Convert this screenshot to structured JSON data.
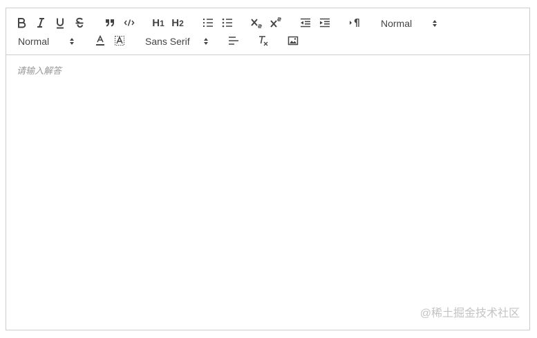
{
  "toolbar": {
    "row1": [
      {
        "name": "bold-button",
        "icon": "bold-icon"
      },
      {
        "name": "italic-button",
        "icon": "italic-icon"
      },
      {
        "name": "underline-button",
        "icon": "underline-icon"
      },
      {
        "name": "strike-button",
        "icon": "strikethrough-icon"
      },
      {
        "name": "blockquote-button",
        "icon": "quote-icon"
      },
      {
        "name": "code-block-button",
        "icon": "code-icon"
      },
      {
        "name": "header-1-button",
        "label": "H1"
      },
      {
        "name": "header-2-button",
        "label": "H2"
      },
      {
        "name": "ordered-list-button",
        "icon": "ordered-list-icon"
      },
      {
        "name": "bullet-list-button",
        "icon": "bullet-list-icon"
      },
      {
        "name": "subscript-button",
        "icon": "subscript-icon"
      },
      {
        "name": "superscript-button",
        "icon": "superscript-icon"
      },
      {
        "name": "outdent-button",
        "icon": "outdent-icon"
      },
      {
        "name": "indent-button",
        "icon": "indent-icon"
      },
      {
        "name": "rtl-direction-button",
        "icon": "text-direction-icon"
      }
    ],
    "row1_picker": {
      "label": "Normal",
      "icon": "updown-arrows-icon"
    },
    "row2_size_picker": {
      "label": "Normal",
      "icon": "updown-arrows-icon"
    },
    "row2": [
      {
        "name": "text-color-button",
        "icon": "font-color-icon"
      },
      {
        "name": "background-color-button",
        "icon": "background-color-icon"
      }
    ],
    "row2_font_picker": {
      "label": "Sans Serif",
      "icon": "updown-arrows-icon"
    },
    "row2_tail": [
      {
        "name": "align-button",
        "icon": "align-left-icon"
      },
      {
        "name": "clean-format-button",
        "icon": "clear-format-icon"
      },
      {
        "name": "image-button",
        "icon": "image-icon"
      }
    ]
  },
  "editor": {
    "placeholder": "请输入解答"
  },
  "watermark": "@稀土掘金技术社区"
}
